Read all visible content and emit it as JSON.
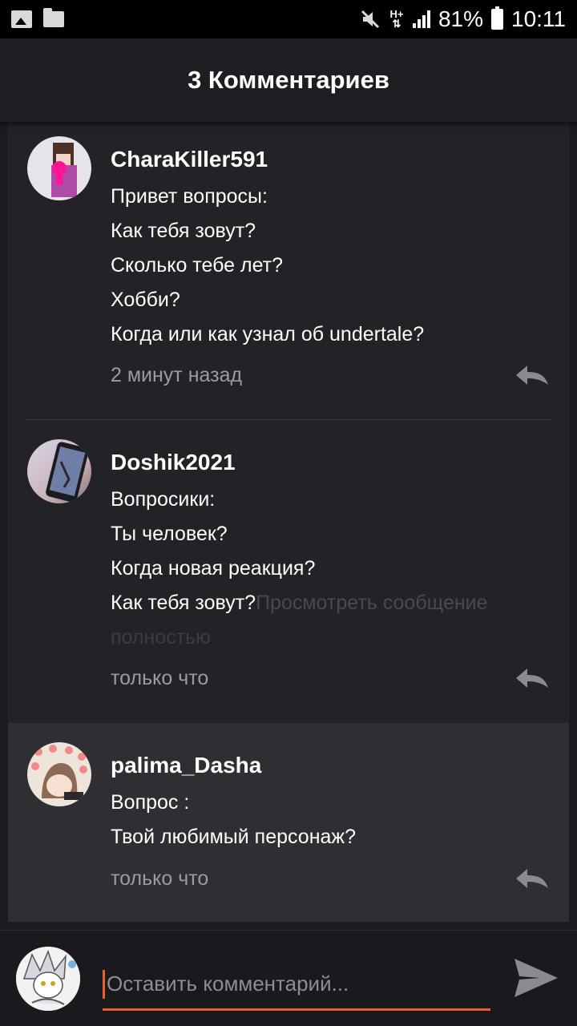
{
  "status_bar": {
    "battery_percent": "81%",
    "time": "10:11",
    "icons": [
      "gallery-icon",
      "folder-icon",
      "mute-icon",
      "ht-network-icon",
      "signal-icon",
      "battery-icon"
    ]
  },
  "header": {
    "title": "3 Комментариев"
  },
  "comments": [
    {
      "username": "CharaKiller591",
      "lines": [
        "Привет вопросы:",
        "Как тебя зовут?",
        "Сколько тебе лет?",
        "Хобби?",
        "Когда или как узнал об undertale?"
      ],
      "time": "2 минут назад"
    },
    {
      "username": "Doshik2021",
      "lines": [
        "Вопросики:",
        "Ты человек?",
        "Когда новая реакция?",
        "Как тебя зовут?"
      ],
      "more_link_part1": "Просмотреть сообщение",
      "more_link_part2": "полностью",
      "time": "только что"
    },
    {
      "username": "palima_Dasha",
      "lines": [
        "Вопрос :",
        "Твой любимый персонаж?"
      ],
      "time": "только что"
    }
  ],
  "input": {
    "placeholder": "Оставить комментарий...",
    "value": ""
  },
  "colors": {
    "accent": "#e8602c",
    "background": "#1c1b1f",
    "highlight_row": "#2f2e33"
  }
}
